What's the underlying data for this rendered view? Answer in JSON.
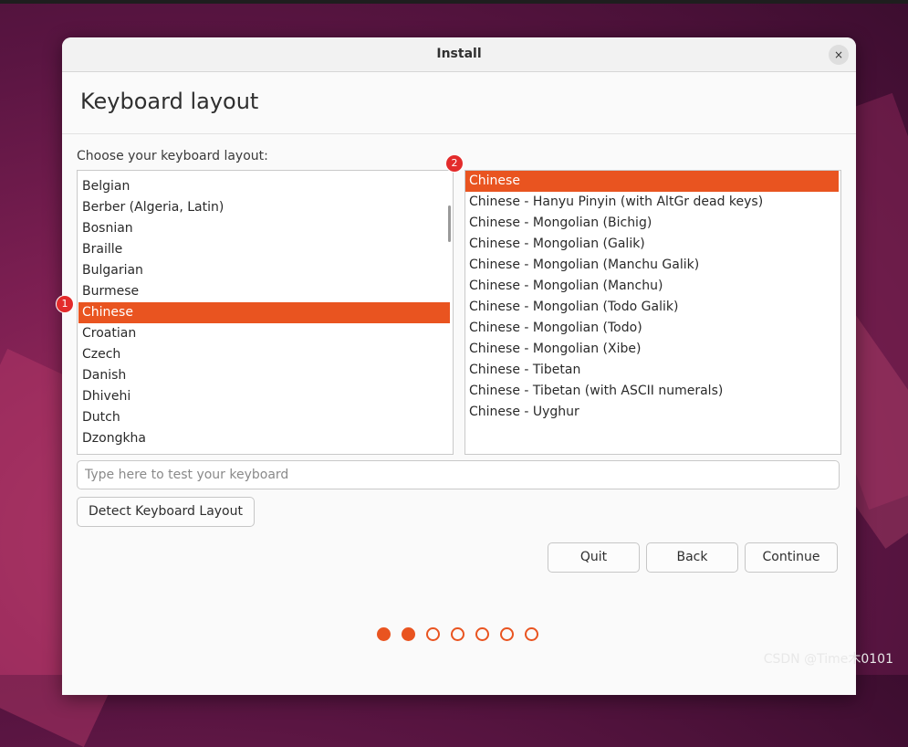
{
  "window": {
    "title": "Install",
    "close_glyph": "×"
  },
  "page": {
    "heading": "Keyboard layout",
    "choose_label": "Choose your keyboard layout:"
  },
  "layouts": [
    {
      "label": "Belgian",
      "selected": false
    },
    {
      "label": "Berber (Algeria, Latin)",
      "selected": false
    },
    {
      "label": "Bosnian",
      "selected": false
    },
    {
      "label": "Braille",
      "selected": false
    },
    {
      "label": "Bulgarian",
      "selected": false
    },
    {
      "label": "Burmese",
      "selected": false
    },
    {
      "label": "Chinese",
      "selected": true
    },
    {
      "label": "Croatian",
      "selected": false
    },
    {
      "label": "Czech",
      "selected": false
    },
    {
      "label": "Danish",
      "selected": false
    },
    {
      "label": "Dhivehi",
      "selected": false
    },
    {
      "label": "Dutch",
      "selected": false
    },
    {
      "label": "Dzongkha",
      "selected": false
    }
  ],
  "variants": [
    {
      "label": "Chinese",
      "selected": true
    },
    {
      "label": "Chinese - Hanyu Pinyin (with AltGr dead keys)",
      "selected": false
    },
    {
      "label": "Chinese - Mongolian (Bichig)",
      "selected": false
    },
    {
      "label": "Chinese - Mongolian (Galik)",
      "selected": false
    },
    {
      "label": "Chinese - Mongolian (Manchu Galik)",
      "selected": false
    },
    {
      "label": "Chinese - Mongolian (Manchu)",
      "selected": false
    },
    {
      "label": "Chinese - Mongolian (Todo Galik)",
      "selected": false
    },
    {
      "label": "Chinese - Mongolian (Todo)",
      "selected": false
    },
    {
      "label": "Chinese - Mongolian (Xibe)",
      "selected": false
    },
    {
      "label": "Chinese - Tibetan",
      "selected": false
    },
    {
      "label": "Chinese - Tibetan (with ASCII numerals)",
      "selected": false
    },
    {
      "label": "Chinese - Uyghur",
      "selected": false
    }
  ],
  "badges": {
    "first": "1",
    "second": "2"
  },
  "test_input": {
    "value": "",
    "placeholder": "Type here to test your keyboard"
  },
  "buttons": {
    "detect": "Detect Keyboard Layout",
    "quit": "Quit",
    "back": "Back",
    "continue": "Continue"
  },
  "progress": {
    "total_steps": 7,
    "current_step": 2
  },
  "colors": {
    "accent": "#e95420",
    "badge": "#e32b2b"
  },
  "watermark": "CSDN @Time木0101"
}
